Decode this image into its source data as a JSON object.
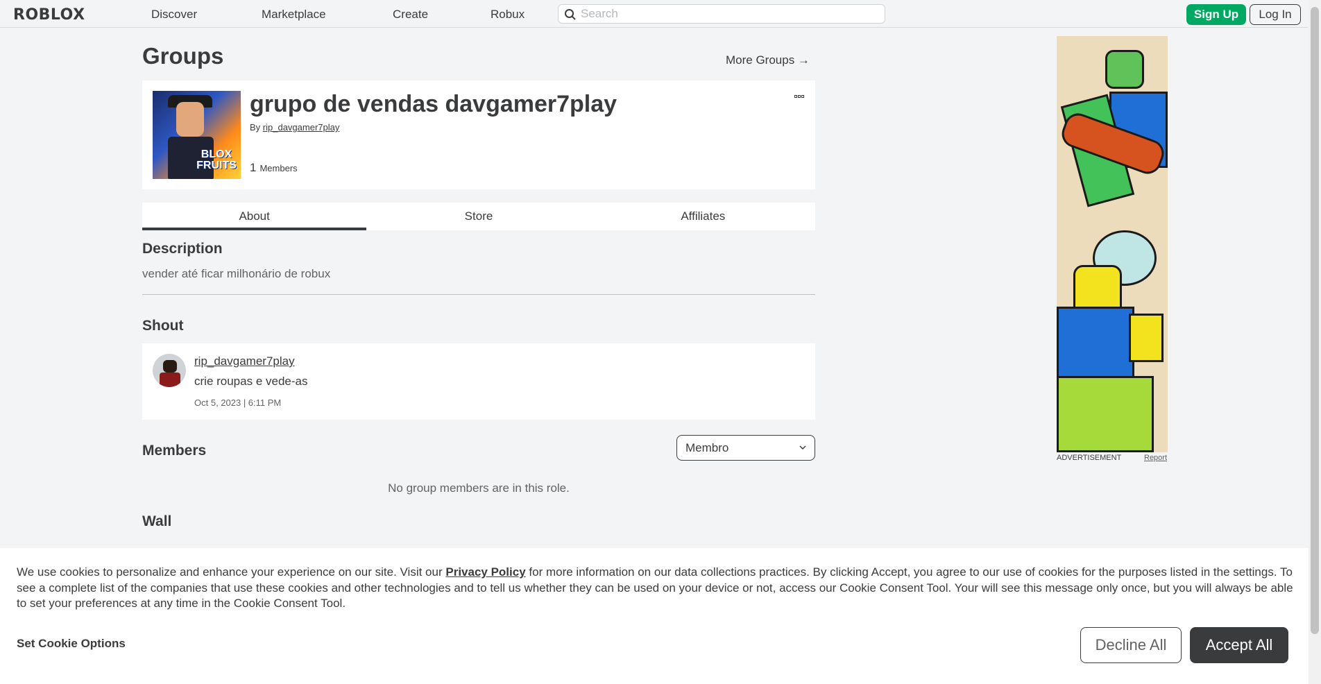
{
  "header": {
    "logo": "ROBLOX",
    "nav": [
      "Discover",
      "Marketplace",
      "Create",
      "Robux"
    ],
    "search_placeholder": "Search",
    "signup_label": "Sign Up",
    "login_label": "Log In"
  },
  "main": {
    "title": "Groups",
    "more_groups": "More Groups →",
    "group": {
      "name": "grupo de vendas davgamer7play",
      "by_prefix": "By",
      "owner": "rip_davgamer7play",
      "member_count": "1",
      "members_label": "Members",
      "thumbnail_text": "BLOX FRUITS"
    },
    "tabs": [
      "About",
      "Store",
      "Affiliates"
    ],
    "description": {
      "title": "Description",
      "text": "vender até ficar milhonário de robux"
    },
    "shout": {
      "title": "Shout",
      "user": "rip_davgamer7play",
      "body": "crie roupas e vede-as",
      "time": "Oct 5, 2023 | 6:11 PM"
    },
    "members": {
      "title": "Members",
      "role_selected": "Membro",
      "empty_text": "No group members are in this role."
    },
    "wall": {
      "title": "Wall"
    }
  },
  "ad": {
    "label": "ADVERTISEMENT",
    "report": "Report"
  },
  "cookie": {
    "text_before": "We use cookies to personalize and enhance your experience on our site. Visit our ",
    "link": "Privacy Policy",
    "text_after": " for more information on our data collections practices. By clicking Accept, you agree to our use of cookies for the purposes listed in the settings. To see a complete list of the companies that use these cookies and other technologies and to tell us whether they can be used on your device or not, access our Cookie Consent Tool. Your will see this message only once, but you will always be able to set your preferences at any time in the Cookie Consent Tool.",
    "set_options": "Set Cookie Options",
    "decline": "Decline All",
    "accept": "Accept All"
  },
  "colors": {
    "accent_green": "#00a862",
    "text_dark": "#393b3d",
    "background": "#f2f4f5"
  }
}
